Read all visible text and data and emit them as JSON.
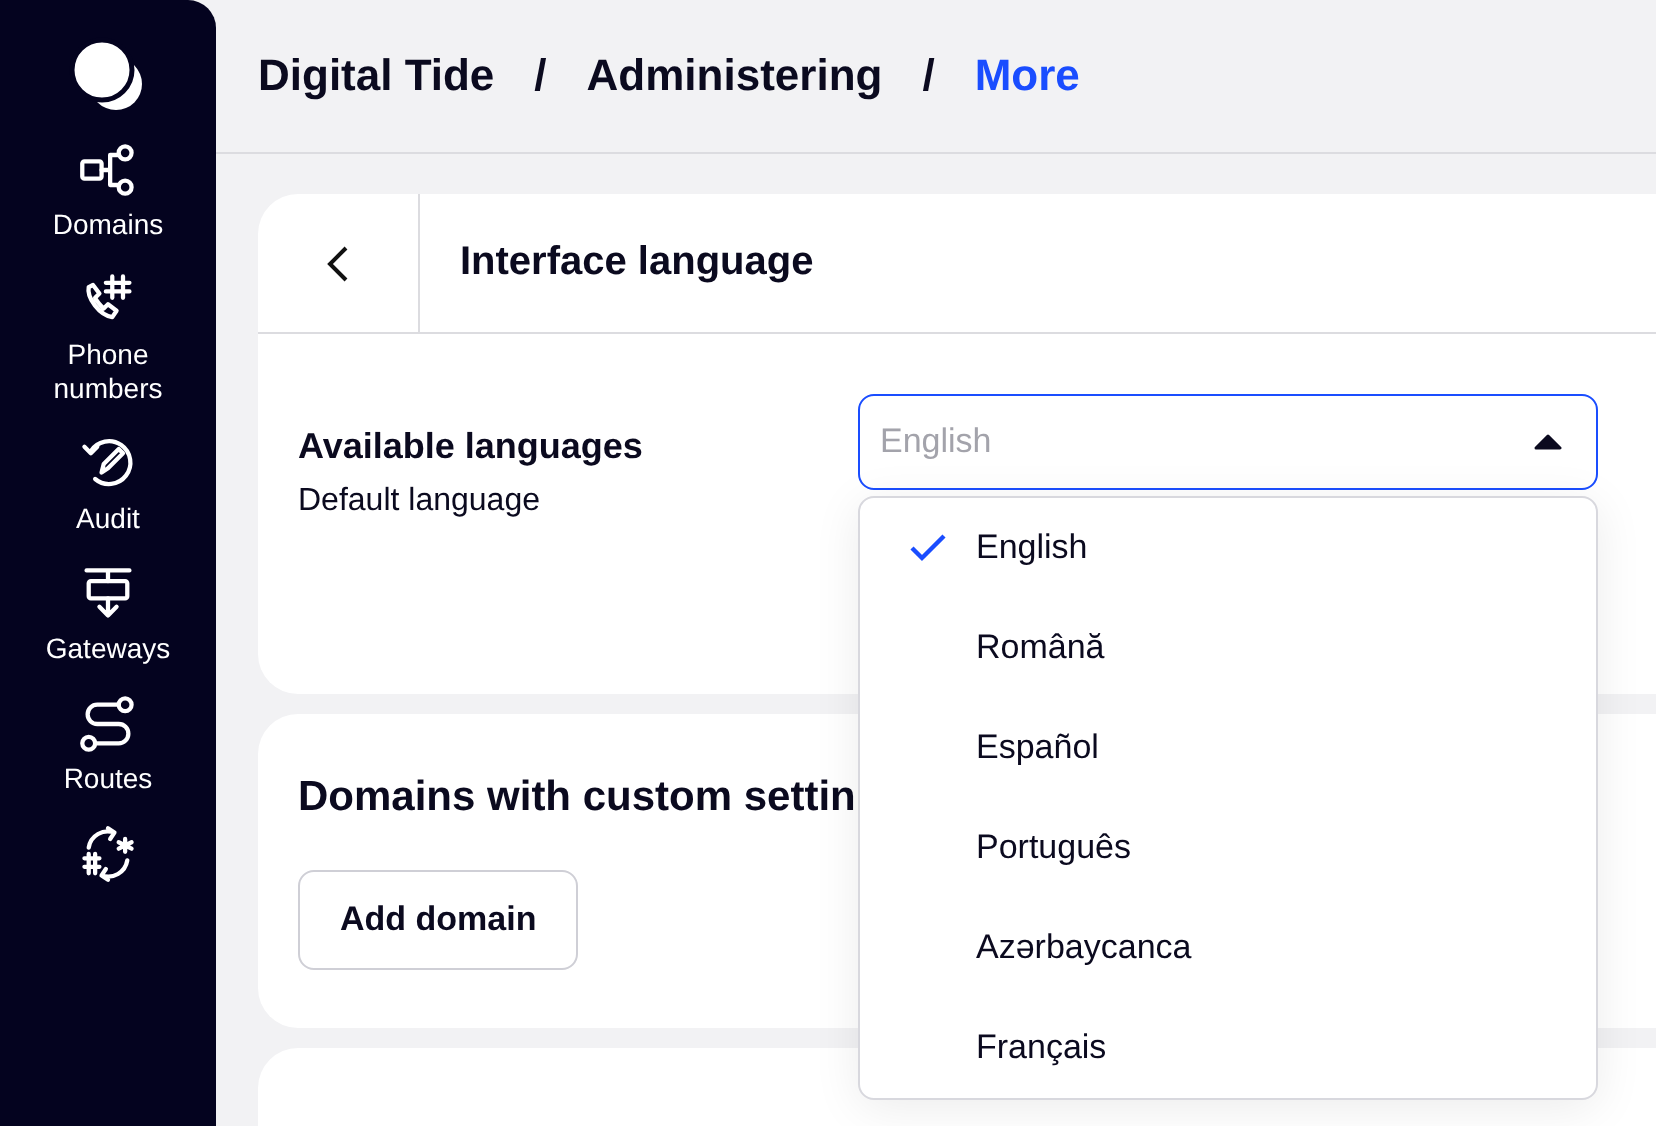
{
  "sidebar": {
    "items": [
      {
        "kind": "domains",
        "label": "Domains"
      },
      {
        "kind": "phone",
        "label": "Phone numbers"
      },
      {
        "kind": "audit",
        "label": "Audit"
      },
      {
        "kind": "gateways",
        "label": "Gateways"
      },
      {
        "kind": "routes",
        "label": "Routes"
      },
      {
        "kind": "numbering"
      }
    ]
  },
  "breadcrumb": [
    {
      "label": "Digital Tide",
      "current": false
    },
    {
      "label": "Administering",
      "current": false
    },
    {
      "label": "More",
      "current": true
    }
  ],
  "breadcrumb_separator": "/",
  "language_card": {
    "title": "Interface language",
    "label": "Available languages",
    "sublabel": "Default language",
    "select": {
      "placeholder": "English",
      "expanded": true
    },
    "options": [
      {
        "label": "English",
        "selected": true
      },
      {
        "label": "Română",
        "selected": false
      },
      {
        "label": "Español",
        "selected": false
      },
      {
        "label": "Português",
        "selected": false
      },
      {
        "label": "Azərbaycanca",
        "selected": false
      },
      {
        "label": "Français",
        "selected": false
      }
    ]
  },
  "domains_card": {
    "title": "Domains with custom settin",
    "button": "Add domain"
  }
}
